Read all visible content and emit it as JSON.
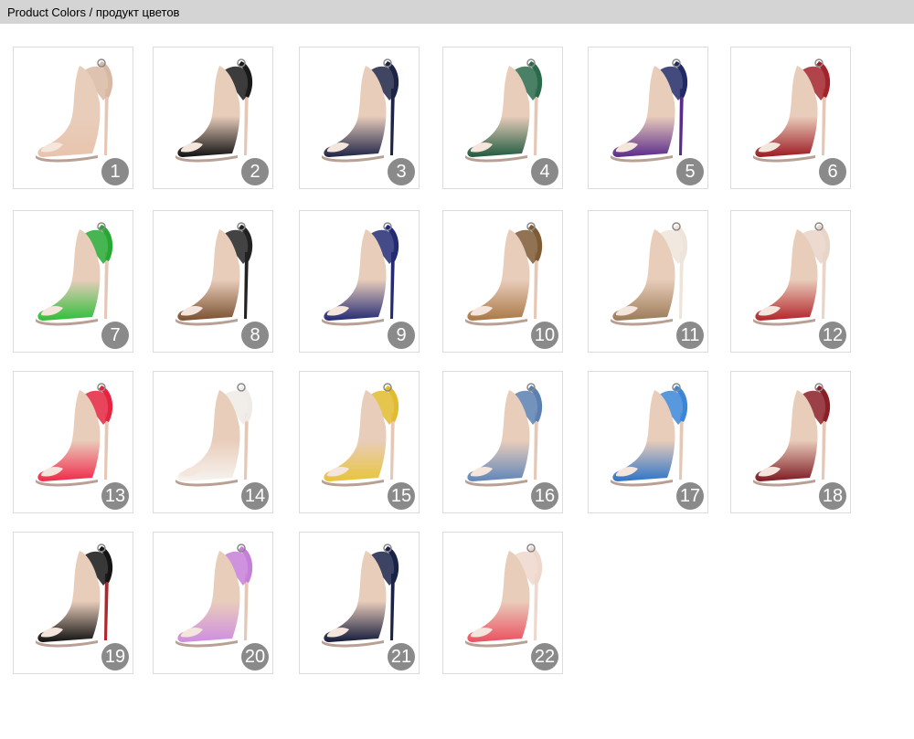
{
  "header": {
    "title": "Product Colors / продукт цветов"
  },
  "variants": [
    {
      "label": "1",
      "color": "#e8c4ad",
      "strap": "#d9b8a3",
      "heel": "#e6c7b5"
    },
    {
      "label": "2",
      "color": "#111111",
      "strap": "#1a1a1a",
      "heel": "#e6c7b5"
    },
    {
      "label": "3",
      "color": "#1e2447",
      "strap": "#1e2447",
      "heel": "#1e2447"
    },
    {
      "label": "4",
      "color": "#1f5a3f",
      "strap": "#2a6a4b",
      "heel": "#e6c7b5"
    },
    {
      "label": "5",
      "color": "#5b2b8c",
      "strap": "#222a66",
      "heel": "#5b2b8c"
    },
    {
      "label": "6",
      "color": "#9c1b22",
      "strap": "#a3232a",
      "heel": "#e6c7b5"
    },
    {
      "label": "7",
      "color": "#2fbe3a",
      "strap": "#27a832",
      "heel": "#e6c7b5"
    },
    {
      "label": "8",
      "color": "#7a5030",
      "strap": "#222222",
      "heel": "#222222"
    },
    {
      "label": "9",
      "color": "#242a74",
      "strap": "#242a74",
      "heel": "#242a74"
    },
    {
      "label": "10",
      "color": "#a97845",
      "strap": "#7e5a35",
      "heel": "#e6c7b5"
    },
    {
      "label": "11",
      "color": "#9b7b57",
      "strap": "#efe4da",
      "heel": "#efe4da"
    },
    {
      "label": "12",
      "color": "#b3242a",
      "strap": "#e9d4c8",
      "heel": "#e9d4c8"
    },
    {
      "label": "13",
      "color": "#f0294a",
      "strap": "#e4243f",
      "heel": "#e6c7b5"
    },
    {
      "label": "14",
      "color": "#f6f3ef",
      "strap": "#efebe6",
      "heel": "#e6c7b5"
    },
    {
      "label": "15",
      "color": "#e8c43b",
      "strap": "#e2bb30",
      "heel": "#e6c7b5"
    },
    {
      "label": "16",
      "color": "#5f86b9",
      "strap": "#5a7fb0",
      "heel": "#e6c7b5"
    },
    {
      "label": "17",
      "color": "#2e74c7",
      "strap": "#3b86d6",
      "heel": "#e6c7b5"
    },
    {
      "label": "18",
      "color": "#7e1a22",
      "strap": "#8a1f27",
      "heel": "#e6c7b5"
    },
    {
      "label": "19",
      "color": "#111111",
      "strap": "#151515",
      "heel": "#b0262a"
    },
    {
      "label": "20",
      "color": "#cf8ee0",
      "strap": "#c57fd8",
      "heel": "#e6c7b5"
    },
    {
      "label": "21",
      "color": "#141a3a",
      "strap": "#1a2248",
      "heel": "#1a2248"
    },
    {
      "label": "22",
      "color": "#ea5160",
      "strap": "#eed7cd",
      "heel": "#eed7cd"
    }
  ]
}
